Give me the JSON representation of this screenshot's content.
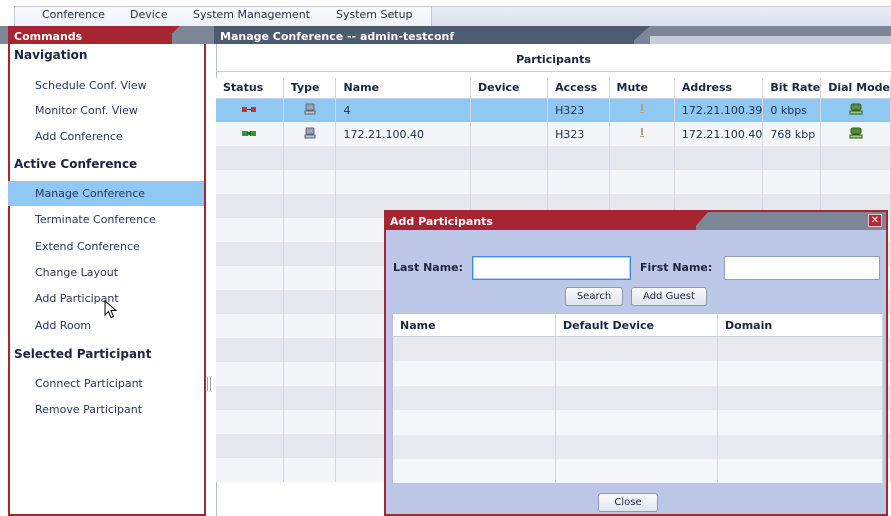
{
  "menu": {
    "items": [
      "Conference",
      "Device",
      "System Management",
      "System Setup"
    ]
  },
  "commands": {
    "tab_label": "Commands",
    "sections": [
      {
        "title": "Navigation",
        "items": [
          "Schedule Conf. View",
          "Monitor Conf. View",
          "Add Conference"
        ]
      },
      {
        "title": "Active Conference",
        "items": [
          "Manage Conference",
          "Terminate Conference",
          "Extend Conference",
          "Change Layout",
          "Add Participant",
          "Add Room"
        ]
      },
      {
        "title": "Selected Participant",
        "items": [
          "Connect Participant",
          "Remove Participant"
        ]
      }
    ],
    "selected_item": "Manage Conference"
  },
  "manage": {
    "tab_label": "Manage Conference -- admin-testconf",
    "section_title": "Participants",
    "columns": [
      "Status",
      "Type",
      "Name",
      "Device",
      "Access",
      "Mute",
      "Address",
      "Bit Rate",
      "Dial Mode"
    ],
    "rows": [
      {
        "status": "disconnected-icon",
        "type": "phone-icon",
        "name": "4",
        "device": "",
        "access": "H323",
        "mute": "mic-icon",
        "address": "172.21.100.39",
        "bitrate": "0 kbps",
        "dialmode": "dial-out-icon"
      },
      {
        "status": "connected-icon",
        "type": "phone-icon",
        "name": "172.21.100.40",
        "device": "",
        "access": "H323",
        "mute": "mic-icon",
        "address": "172.21.100.40",
        "bitrate": "768 kbp",
        "dialmode": "dial-in-icon"
      }
    ]
  },
  "dialog": {
    "title": "Add Participants",
    "last_name_label": "Last Name:",
    "first_name_label": "First Name:",
    "last_name_value": "",
    "first_name_value": "",
    "search_label": "Search",
    "add_guest_label": "Add Guest",
    "columns": [
      "Name",
      "Default Device",
      "Domain"
    ],
    "close_label": "Close",
    "close_icon": "✕"
  },
  "colors": {
    "accent_red": "#a52530",
    "selection_blue": "#8fc8f3",
    "dialog_bg": "#bdc8e8",
    "header_gray": "#7d8697"
  }
}
